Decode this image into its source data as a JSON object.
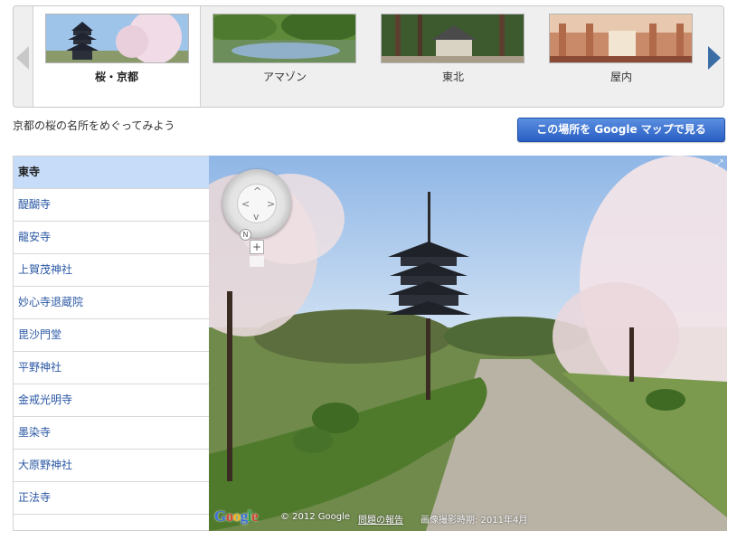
{
  "carousel": {
    "tabs": [
      {
        "label": "桜・京都",
        "active": true
      },
      {
        "label": "アマゾン",
        "active": false
      },
      {
        "label": "東北",
        "active": false
      },
      {
        "label": "屋内",
        "active": false
      }
    ]
  },
  "intro_text": "京都の桜の名所をめぐってみよう",
  "maps_button_label": "この場所を Google マップで見る",
  "locations": [
    "東寺",
    "醍醐寺",
    "龍安寺",
    "上賀茂神社",
    "妙心寺退蔵院",
    "毘沙門堂",
    "平野神社",
    "金戒光明寺",
    "墨染寺",
    "大原野神社",
    "正法寺"
  ],
  "selected_location": "東寺",
  "pano": {
    "compass_label": "N",
    "zoom_label": "+",
    "copyright": "© 2012 Google",
    "report_link": "問題の報告",
    "capture_date": "画像撮影時期: 2011年4月"
  },
  "colors": {
    "accent": "#2a5fc4",
    "selected_row": "#c7dcf9",
    "link": "#2a57a3"
  }
}
